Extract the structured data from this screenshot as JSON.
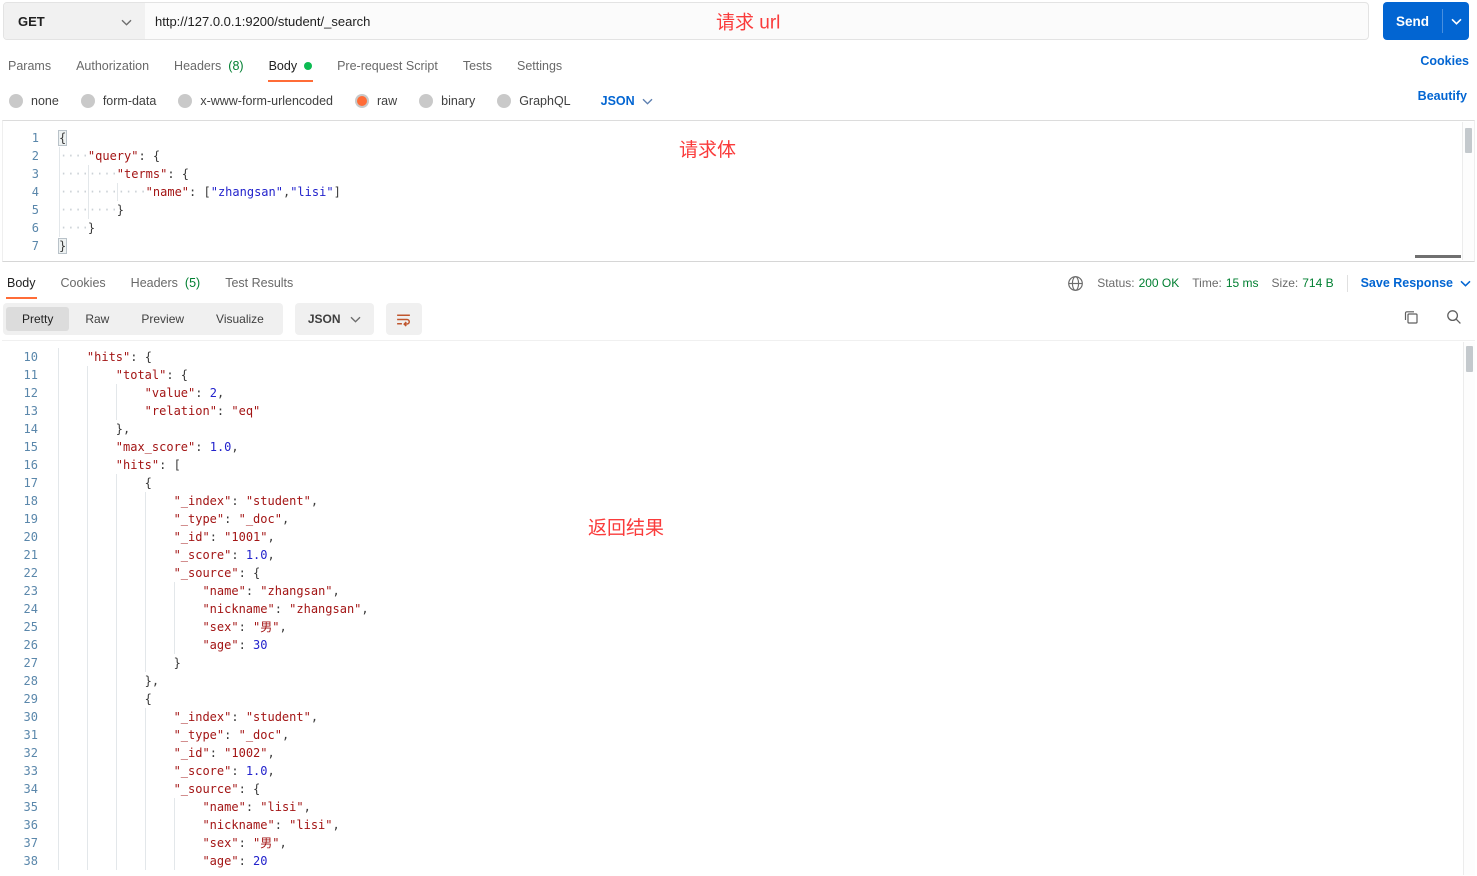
{
  "request_bar": {
    "method": "GET",
    "url": "http://127.0.0.1:9200/student/_search",
    "annotation": "请求 url",
    "send_label": "Send"
  },
  "request_tabs": {
    "items": [
      {
        "label": "Params"
      },
      {
        "label": "Authorization"
      },
      {
        "label": "Headers",
        "count": "(8)"
      },
      {
        "label": "Body",
        "dot": true,
        "active": true
      },
      {
        "label": "Pre-request Script"
      },
      {
        "label": "Tests"
      },
      {
        "label": "Settings"
      }
    ],
    "cookies_link": "Cookies"
  },
  "body_type_bar": {
    "options": [
      {
        "label": "none"
      },
      {
        "label": "form-data"
      },
      {
        "label": "x-www-form-urlencoded"
      },
      {
        "label": "raw",
        "selected": true
      },
      {
        "label": "binary"
      },
      {
        "label": "GraphQL"
      }
    ],
    "language": "JSON",
    "beautify_link": "Beautify"
  },
  "request_editor": {
    "annotation": "请求体",
    "indent": "dots",
    "lines": [
      {
        "n": 1,
        "ind": 0,
        "tk": [
          [
            "bm",
            "{"
          ]
        ]
      },
      {
        "n": 2,
        "ind": 1,
        "tk": [
          [
            "k",
            "\"query\""
          ],
          [
            "p",
            ": {"
          ]
        ]
      },
      {
        "n": 3,
        "ind": 2,
        "tk": [
          [
            "k",
            "\"terms\""
          ],
          [
            "p",
            ": {"
          ]
        ]
      },
      {
        "n": 4,
        "ind": 3,
        "tk": [
          [
            "k",
            "\"name\""
          ],
          [
            "p",
            ": ["
          ],
          [
            "s",
            "\"zhangsan\""
          ],
          [
            "p",
            ","
          ],
          [
            "s",
            "\"lisi\""
          ],
          [
            "p",
            "]"
          ]
        ]
      },
      {
        "n": 5,
        "ind": 2,
        "tk": [
          [
            "p",
            "}"
          ]
        ]
      },
      {
        "n": 6,
        "ind": 1,
        "tk": [
          [
            "p",
            "}"
          ]
        ]
      },
      {
        "n": 7,
        "ind": 0,
        "tk": [
          [
            "bm",
            "}"
          ]
        ]
      }
    ]
  },
  "response_meta": {
    "tabs": [
      {
        "label": "Body",
        "active": true
      },
      {
        "label": "Cookies"
      },
      {
        "label": "Headers",
        "count": "(5)"
      },
      {
        "label": "Test Results"
      }
    ],
    "status_label": "Status:",
    "status_value": "200 OK",
    "time_label": "Time:",
    "time_value": "15 ms",
    "size_label": "Size:",
    "size_value": "714 B",
    "save_response_label": "Save Response"
  },
  "response_toolbar": {
    "views": [
      {
        "label": "Pretty",
        "active": true
      },
      {
        "label": "Raw"
      },
      {
        "label": "Preview"
      },
      {
        "label": "Visualize"
      }
    ],
    "language": "JSON"
  },
  "response_editor": {
    "annotation": "返回结果",
    "indent": "guides",
    "lines": [
      {
        "n": 10,
        "ind": 1,
        "tk": [
          [
            "k",
            "\"hits\""
          ],
          [
            "p",
            ": {"
          ]
        ]
      },
      {
        "n": 11,
        "ind": 2,
        "tk": [
          [
            "k",
            "\"total\""
          ],
          [
            "p",
            ": {"
          ]
        ]
      },
      {
        "n": 12,
        "ind": 3,
        "tk": [
          [
            "k",
            "\"value\""
          ],
          [
            "p",
            ": "
          ],
          [
            "num",
            "2"
          ],
          [
            "p",
            ","
          ]
        ]
      },
      {
        "n": 13,
        "ind": 3,
        "tk": [
          [
            "k",
            "\"relation\""
          ],
          [
            "p",
            ": "
          ],
          [
            "m",
            "\"eq\""
          ]
        ]
      },
      {
        "n": 14,
        "ind": 2,
        "tk": [
          [
            "p",
            "},"
          ]
        ]
      },
      {
        "n": 15,
        "ind": 2,
        "tk": [
          [
            "k",
            "\"max_score\""
          ],
          [
            "p",
            ": "
          ],
          [
            "num",
            "1.0"
          ],
          [
            "p",
            ","
          ]
        ]
      },
      {
        "n": 16,
        "ind": 2,
        "tk": [
          [
            "k",
            "\"hits\""
          ],
          [
            "p",
            ": ["
          ]
        ]
      },
      {
        "n": 17,
        "ind": 3,
        "tk": [
          [
            "p",
            "{"
          ]
        ]
      },
      {
        "n": 18,
        "ind": 4,
        "tk": [
          [
            "k",
            "\"_index\""
          ],
          [
            "p",
            ": "
          ],
          [
            "m",
            "\"student\""
          ],
          [
            "p",
            ","
          ]
        ]
      },
      {
        "n": 19,
        "ind": 4,
        "tk": [
          [
            "k",
            "\"_type\""
          ],
          [
            "p",
            ": "
          ],
          [
            "m",
            "\"_doc\""
          ],
          [
            "p",
            ","
          ]
        ]
      },
      {
        "n": 20,
        "ind": 4,
        "tk": [
          [
            "k",
            "\"_id\""
          ],
          [
            "p",
            ": "
          ],
          [
            "m",
            "\"1001\""
          ],
          [
            "p",
            ","
          ]
        ]
      },
      {
        "n": 21,
        "ind": 4,
        "tk": [
          [
            "k",
            "\"_score\""
          ],
          [
            "p",
            ": "
          ],
          [
            "num",
            "1.0"
          ],
          [
            "p",
            ","
          ]
        ]
      },
      {
        "n": 22,
        "ind": 4,
        "tk": [
          [
            "k",
            "\"_source\""
          ],
          [
            "p",
            ": {"
          ]
        ]
      },
      {
        "n": 23,
        "ind": 5,
        "tk": [
          [
            "k",
            "\"name\""
          ],
          [
            "p",
            ": "
          ],
          [
            "m",
            "\"zhangsan\""
          ],
          [
            "p",
            ","
          ]
        ]
      },
      {
        "n": 24,
        "ind": 5,
        "tk": [
          [
            "k",
            "\"nickname\""
          ],
          [
            "p",
            ": "
          ],
          [
            "m",
            "\"zhangsan\""
          ],
          [
            "p",
            ","
          ]
        ]
      },
      {
        "n": 25,
        "ind": 5,
        "tk": [
          [
            "k",
            "\"sex\""
          ],
          [
            "p",
            ": "
          ],
          [
            "m",
            "\"男\""
          ],
          [
            "p",
            ","
          ]
        ]
      },
      {
        "n": 26,
        "ind": 5,
        "tk": [
          [
            "k",
            "\"age\""
          ],
          [
            "p",
            ": "
          ],
          [
            "num",
            "30"
          ]
        ]
      },
      {
        "n": 27,
        "ind": 4,
        "tk": [
          [
            "p",
            "}"
          ]
        ]
      },
      {
        "n": 28,
        "ind": 3,
        "tk": [
          [
            "p",
            "},"
          ]
        ]
      },
      {
        "n": 29,
        "ind": 3,
        "tk": [
          [
            "p",
            "{"
          ]
        ]
      },
      {
        "n": 30,
        "ind": 4,
        "tk": [
          [
            "k",
            "\"_index\""
          ],
          [
            "p",
            ": "
          ],
          [
            "m",
            "\"student\""
          ],
          [
            "p",
            ","
          ]
        ]
      },
      {
        "n": 31,
        "ind": 4,
        "tk": [
          [
            "k",
            "\"_type\""
          ],
          [
            "p",
            ": "
          ],
          [
            "m",
            "\"_doc\""
          ],
          [
            "p",
            ","
          ]
        ]
      },
      {
        "n": 32,
        "ind": 4,
        "tk": [
          [
            "k",
            "\"_id\""
          ],
          [
            "p",
            ": "
          ],
          [
            "m",
            "\"1002\""
          ],
          [
            "p",
            ","
          ]
        ]
      },
      {
        "n": 33,
        "ind": 4,
        "tk": [
          [
            "k",
            "\"_score\""
          ],
          [
            "p",
            ": "
          ],
          [
            "num",
            "1.0"
          ],
          [
            "p",
            ","
          ]
        ]
      },
      {
        "n": 34,
        "ind": 4,
        "tk": [
          [
            "k",
            "\"_source\""
          ],
          [
            "p",
            ": {"
          ]
        ]
      },
      {
        "n": 35,
        "ind": 5,
        "tk": [
          [
            "k",
            "\"name\""
          ],
          [
            "p",
            ": "
          ],
          [
            "m",
            "\"lisi\""
          ],
          [
            "p",
            ","
          ]
        ]
      },
      {
        "n": 36,
        "ind": 5,
        "tk": [
          [
            "k",
            "\"nickname\""
          ],
          [
            "p",
            ": "
          ],
          [
            "m",
            "\"lisi\""
          ],
          [
            "p",
            ","
          ]
        ]
      },
      {
        "n": 37,
        "ind": 5,
        "tk": [
          [
            "k",
            "\"sex\""
          ],
          [
            "p",
            ": "
          ],
          [
            "m",
            "\"男\""
          ],
          [
            "p",
            ","
          ]
        ]
      },
      {
        "n": 38,
        "ind": 5,
        "tk": [
          [
            "k",
            "\"age\""
          ],
          [
            "p",
            ": "
          ],
          [
            "num",
            "20"
          ]
        ]
      }
    ]
  },
  "colors": {
    "accent_orange": "#FF6C37",
    "link_blue": "#0265D2",
    "success_green": "#007F31",
    "annotation_red": "#FA3B3B",
    "code_key_red": "#A31515",
    "code_value_blue": "#2222CC"
  }
}
